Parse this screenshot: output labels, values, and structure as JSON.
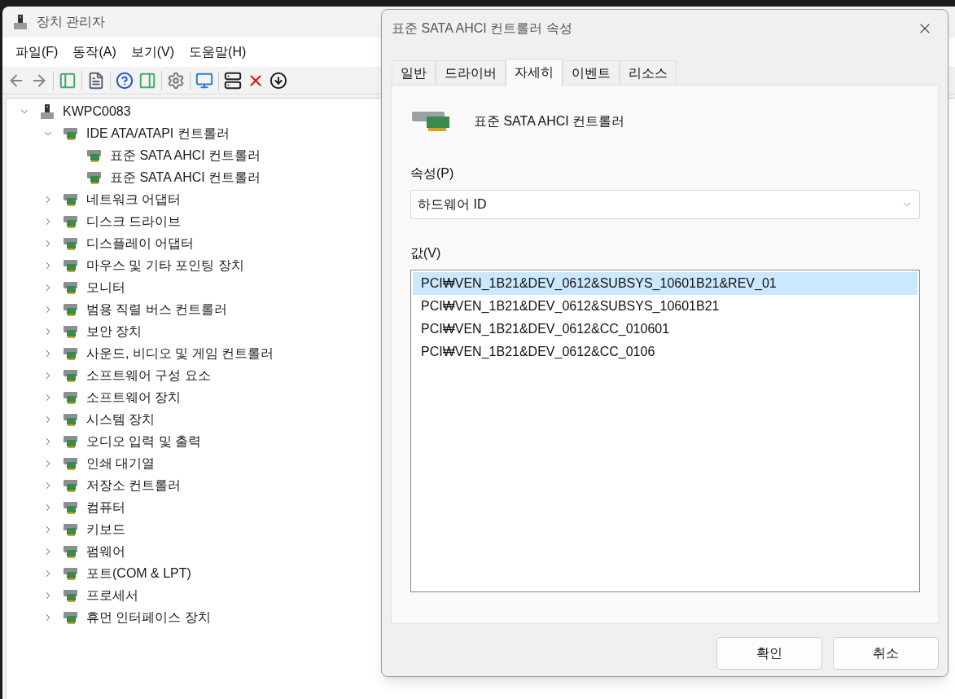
{
  "main_window": {
    "title": "장치 관리자"
  },
  "menu": [
    "파일(F)",
    "동작(A)",
    "보기(V)",
    "도움말(H)"
  ],
  "tree": {
    "label": "KWPC0083",
    "expanded": true,
    "children": [
      {
        "label": "IDE ATA/ATAPI 컨트롤러",
        "expanded": true,
        "children": [
          {
            "label": "표준 SATA AHCI 컨트롤러"
          },
          {
            "label": "표준 SATA AHCI 컨트롤러"
          }
        ]
      },
      {
        "label": "네트워크 어댑터",
        "expanded": false
      },
      {
        "label": "디스크 드라이브",
        "expanded": false
      },
      {
        "label": "디스플레이 어댑터",
        "expanded": false
      },
      {
        "label": "마우스 및 기타 포인팅 장치",
        "expanded": false
      },
      {
        "label": "모니터",
        "expanded": false
      },
      {
        "label": "범용 직렬 버스 컨트롤러",
        "expanded": false
      },
      {
        "label": "보안 장치",
        "expanded": false
      },
      {
        "label": "사운드, 비디오 및 게임 컨트롤러",
        "expanded": false
      },
      {
        "label": "소프트웨어 구성 요소",
        "expanded": false
      },
      {
        "label": "소프트웨어 장치",
        "expanded": false
      },
      {
        "label": "시스템 장치",
        "expanded": false
      },
      {
        "label": "오디오 입력 및 출력",
        "expanded": false
      },
      {
        "label": "인쇄 대기열",
        "expanded": false
      },
      {
        "label": "저장소 컨트롤러",
        "expanded": false
      },
      {
        "label": "컴퓨터",
        "expanded": false
      },
      {
        "label": "키보드",
        "expanded": false
      },
      {
        "label": "펌웨어",
        "expanded": false
      },
      {
        "label": "포트(COM & LPT)",
        "expanded": false
      },
      {
        "label": "프로세서",
        "expanded": false
      },
      {
        "label": "휴먼 인터페이스 장치",
        "expanded": false
      }
    ]
  },
  "dialog": {
    "title": "표준 SATA AHCI 컨트롤러 속성",
    "tabs": [
      {
        "label": "일반",
        "selected": false
      },
      {
        "label": "드라이버",
        "selected": false
      },
      {
        "label": "자세히",
        "selected": true
      },
      {
        "label": "이벤트",
        "selected": false
      },
      {
        "label": "리소스",
        "selected": false
      }
    ],
    "device_name": "표준 SATA AHCI 컨트롤러",
    "property_label": "속성(P)",
    "property_value": "하드웨어 ID",
    "value_label": "값(V)",
    "values": [
      {
        "text": "PCI₩VEN_1B21&DEV_0612&SUBSYS_10601B21&REV_01",
        "selected": true
      },
      {
        "text": "PCI₩VEN_1B21&DEV_0612&SUBSYS_10601B21",
        "selected": false
      },
      {
        "text": "PCI₩VEN_1B21&DEV_0612&CC_010601",
        "selected": false
      },
      {
        "text": "PCI₩VEN_1B21&DEV_0612&CC_0106",
        "selected": false
      }
    ],
    "buttons": [
      "확인",
      "취소"
    ]
  }
}
